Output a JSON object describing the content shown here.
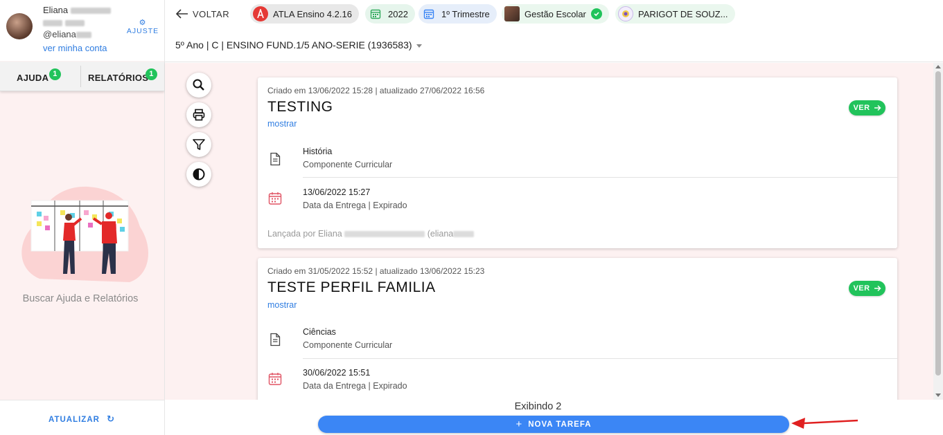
{
  "user": {
    "name": "Eliana",
    "handle": "@eliana",
    "account_link": "ver minha conta",
    "settings_label": "AJUSTE"
  },
  "sidebar": {
    "tabs": [
      {
        "label": "AJUDA",
        "badge": "1"
      },
      {
        "label": "RELATÓRIOS",
        "badge": "1"
      }
    ],
    "help_text": "Buscar Ajuda e Relatórios",
    "refresh_label": "ATUALIZAR"
  },
  "header": {
    "back_label": "VOLTAR",
    "chips": [
      {
        "label": "ATLA Ensino 4.2.16",
        "icon": "atla-logo-icon",
        "color": "#e8e8e8"
      },
      {
        "label": "2022",
        "icon": "calendar-icon",
        "color": "#e6f5ec"
      },
      {
        "label": "1º Trimestre",
        "icon": "calendar-icon",
        "color": "#e6eefa"
      },
      {
        "label": "Gestão Escolar",
        "icon": "check-circle-icon",
        "color": "#eaf7ee"
      },
      {
        "label": "PARIGOT DE SOUZ...",
        "icon": "school-emblem-icon",
        "color": "#eaf7ee"
      }
    ],
    "class_selector": "5º Ano | C | ENSINO FUND.1/5 ANO-SERIE (1936583)"
  },
  "toolbar": [
    "search-icon",
    "print-icon",
    "filter-icon",
    "contrast-icon"
  ],
  "tasks": [
    {
      "meta": "Criado em 13/06/2022 15:28 | atualizado 27/06/2022 16:56",
      "title": "TESTING",
      "show_label": "mostrar",
      "view_label": "VER",
      "subject": "História",
      "subject_type": "Componente Curricular",
      "due_date": "13/06/2022 15:27",
      "due_label": "Data da Entrega | Expirado",
      "author_prefix": "Lançada por Eliana",
      "author_suffix": "(eliana"
    },
    {
      "meta": "Criado em 31/05/2022 15:52 | atualizado 13/06/2022 15:23",
      "title": "TESTE PERFIL FAMILIA",
      "show_label": "mostrar",
      "view_label": "VER",
      "subject": "Ciências",
      "subject_type": "Componente Curricular",
      "due_date": "30/06/2022 15:51",
      "due_label": "Data da Entrega | Expirado"
    }
  ],
  "footer": {
    "count_text": "Exibindo 2",
    "new_task_label": "NOVA TAREFA"
  },
  "colors": {
    "accent_blue": "#3b86f5",
    "success_green": "#21c35b",
    "annotation_red": "#e02020"
  }
}
